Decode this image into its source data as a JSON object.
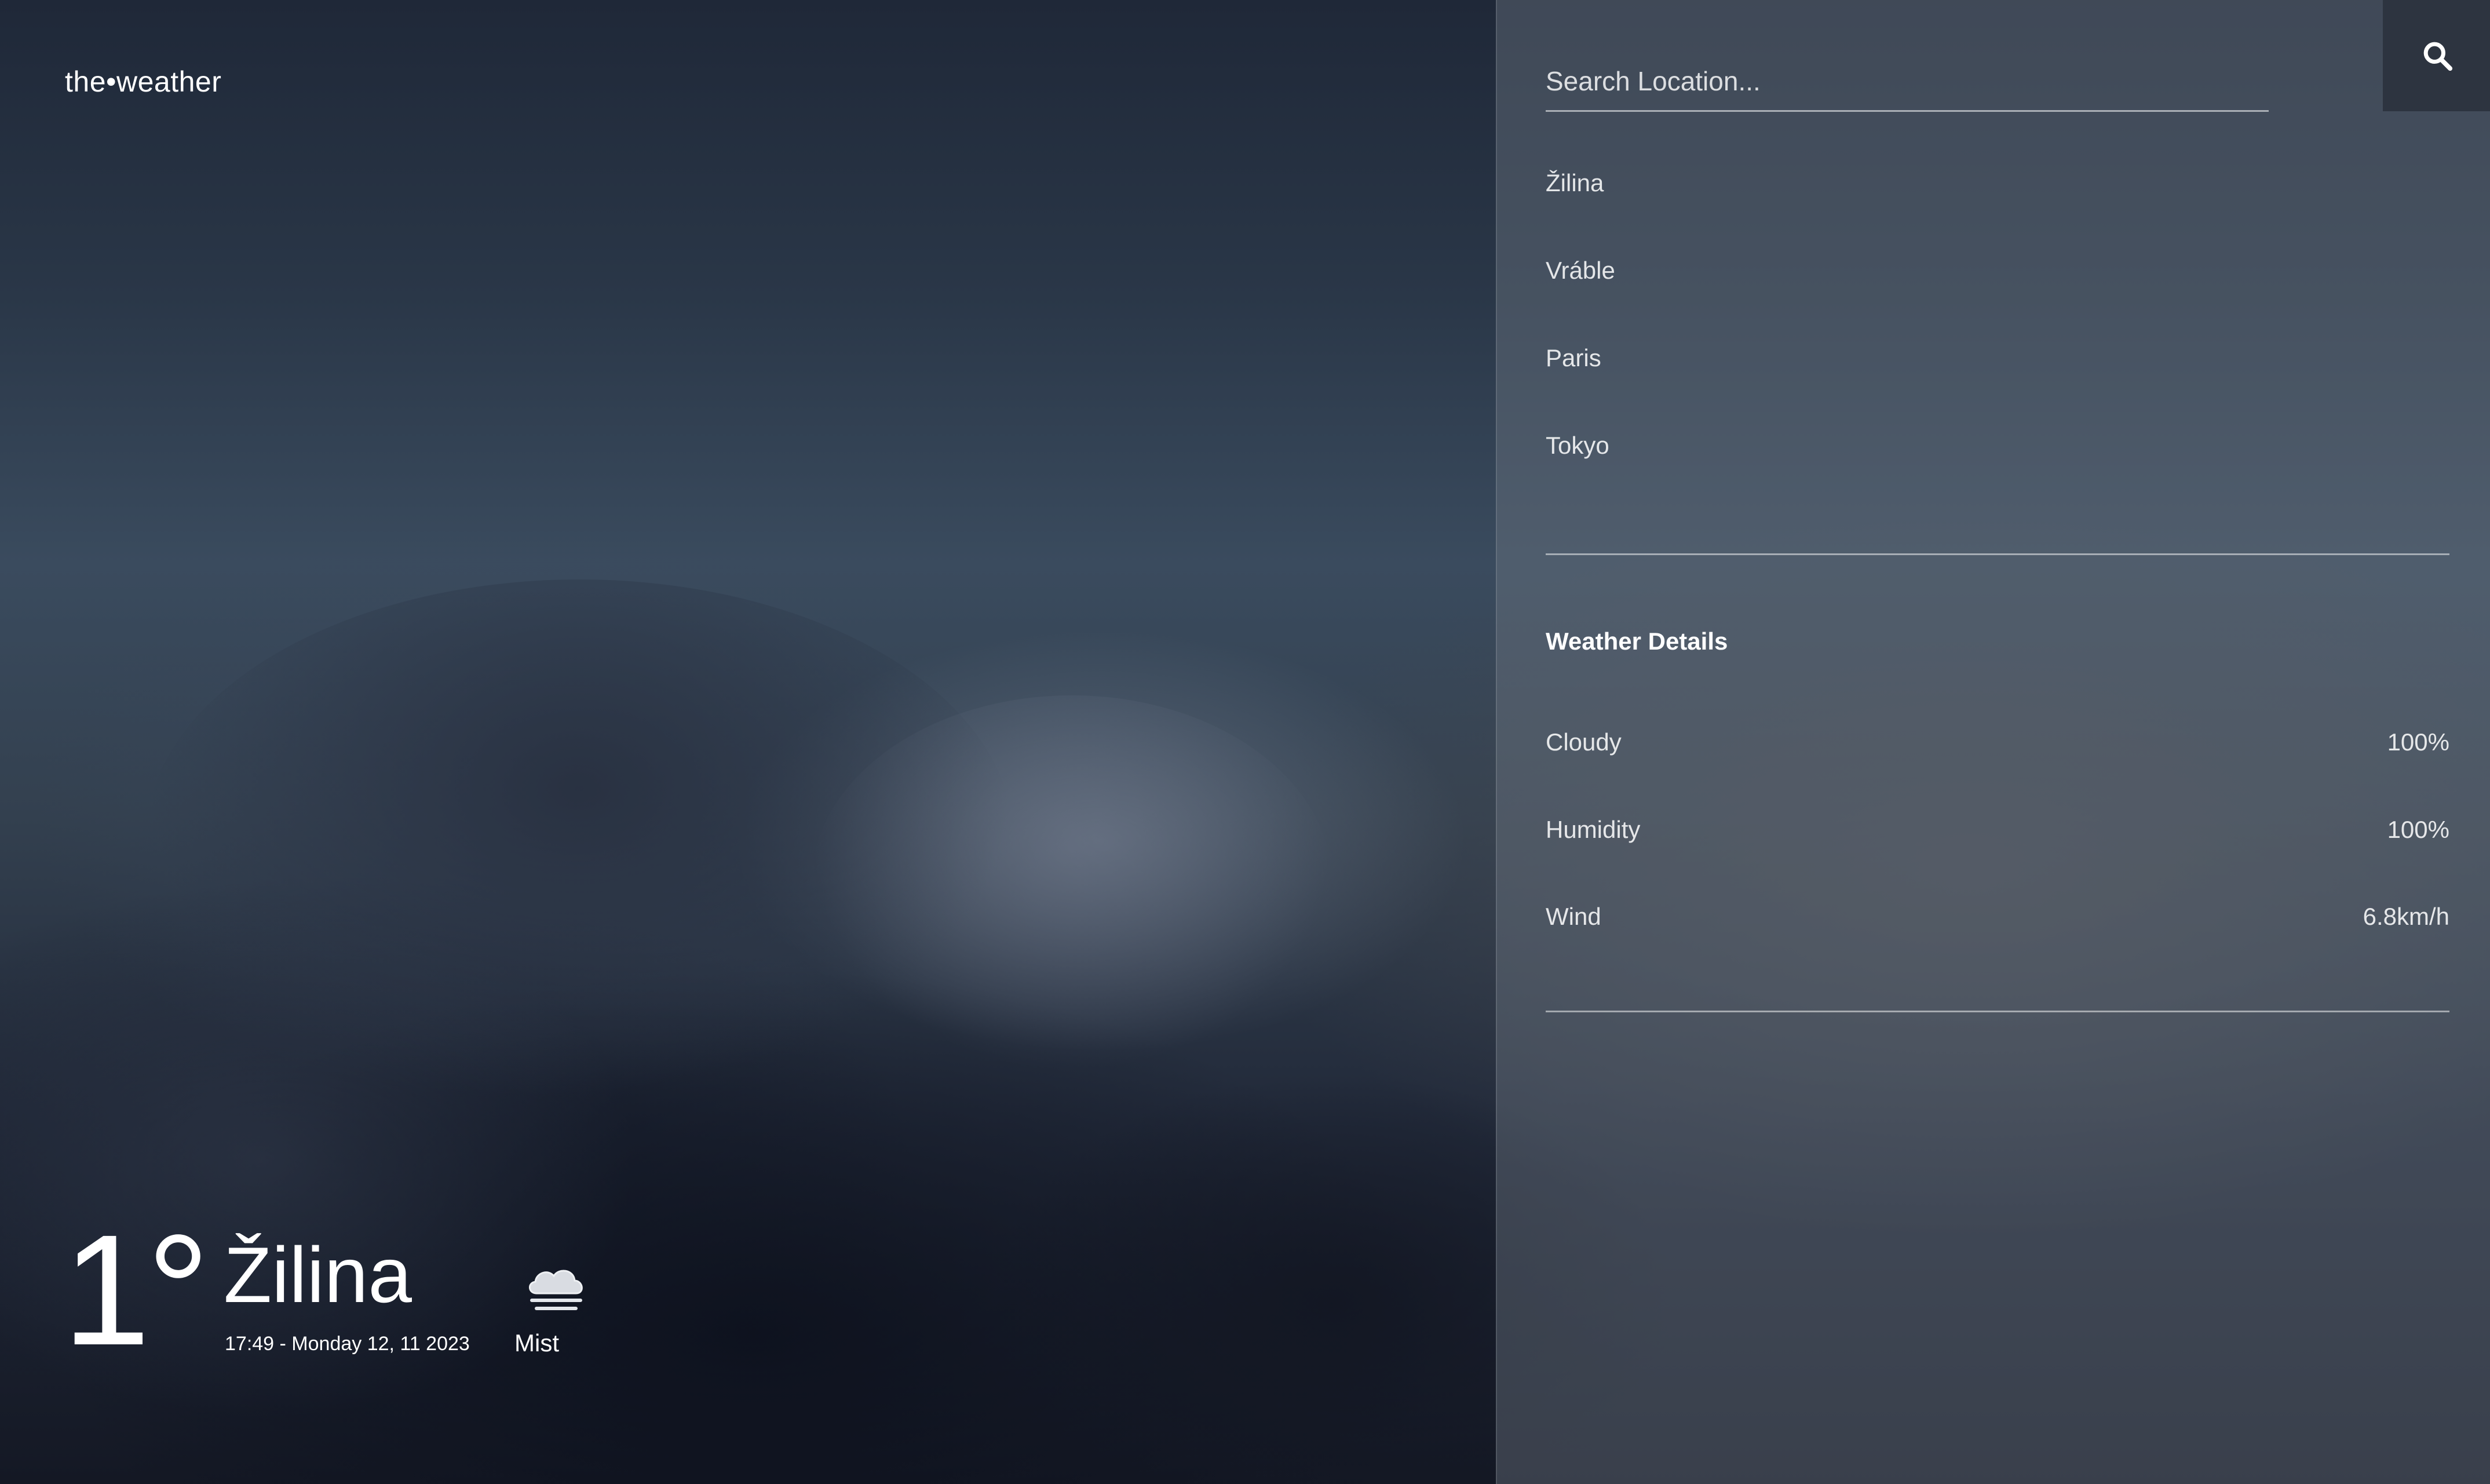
{
  "brand": {
    "name": "the•weather"
  },
  "search": {
    "placeholder": "Search Location..."
  },
  "locations": [
    "Žilina",
    "Vráble",
    "Paris",
    "Tokyo"
  ],
  "details": {
    "title": "Weather Details",
    "rows": [
      {
        "label": "Cloudy",
        "value": "100%"
      },
      {
        "label": "Humidity",
        "value": "100%"
      },
      {
        "label": "Wind",
        "value": "6.8km/h"
      }
    ]
  },
  "current": {
    "temperature": "1°",
    "city": "Žilina",
    "datetime": "17:49 - Monday 12, 11 2023",
    "condition": "Mist",
    "condition_icon": "mist-cloud-icon"
  },
  "icons": {
    "search": "search-icon"
  },
  "colors": {
    "panel": "#6e7682",
    "search_button": "#2d3440",
    "text": "#ffffff"
  }
}
